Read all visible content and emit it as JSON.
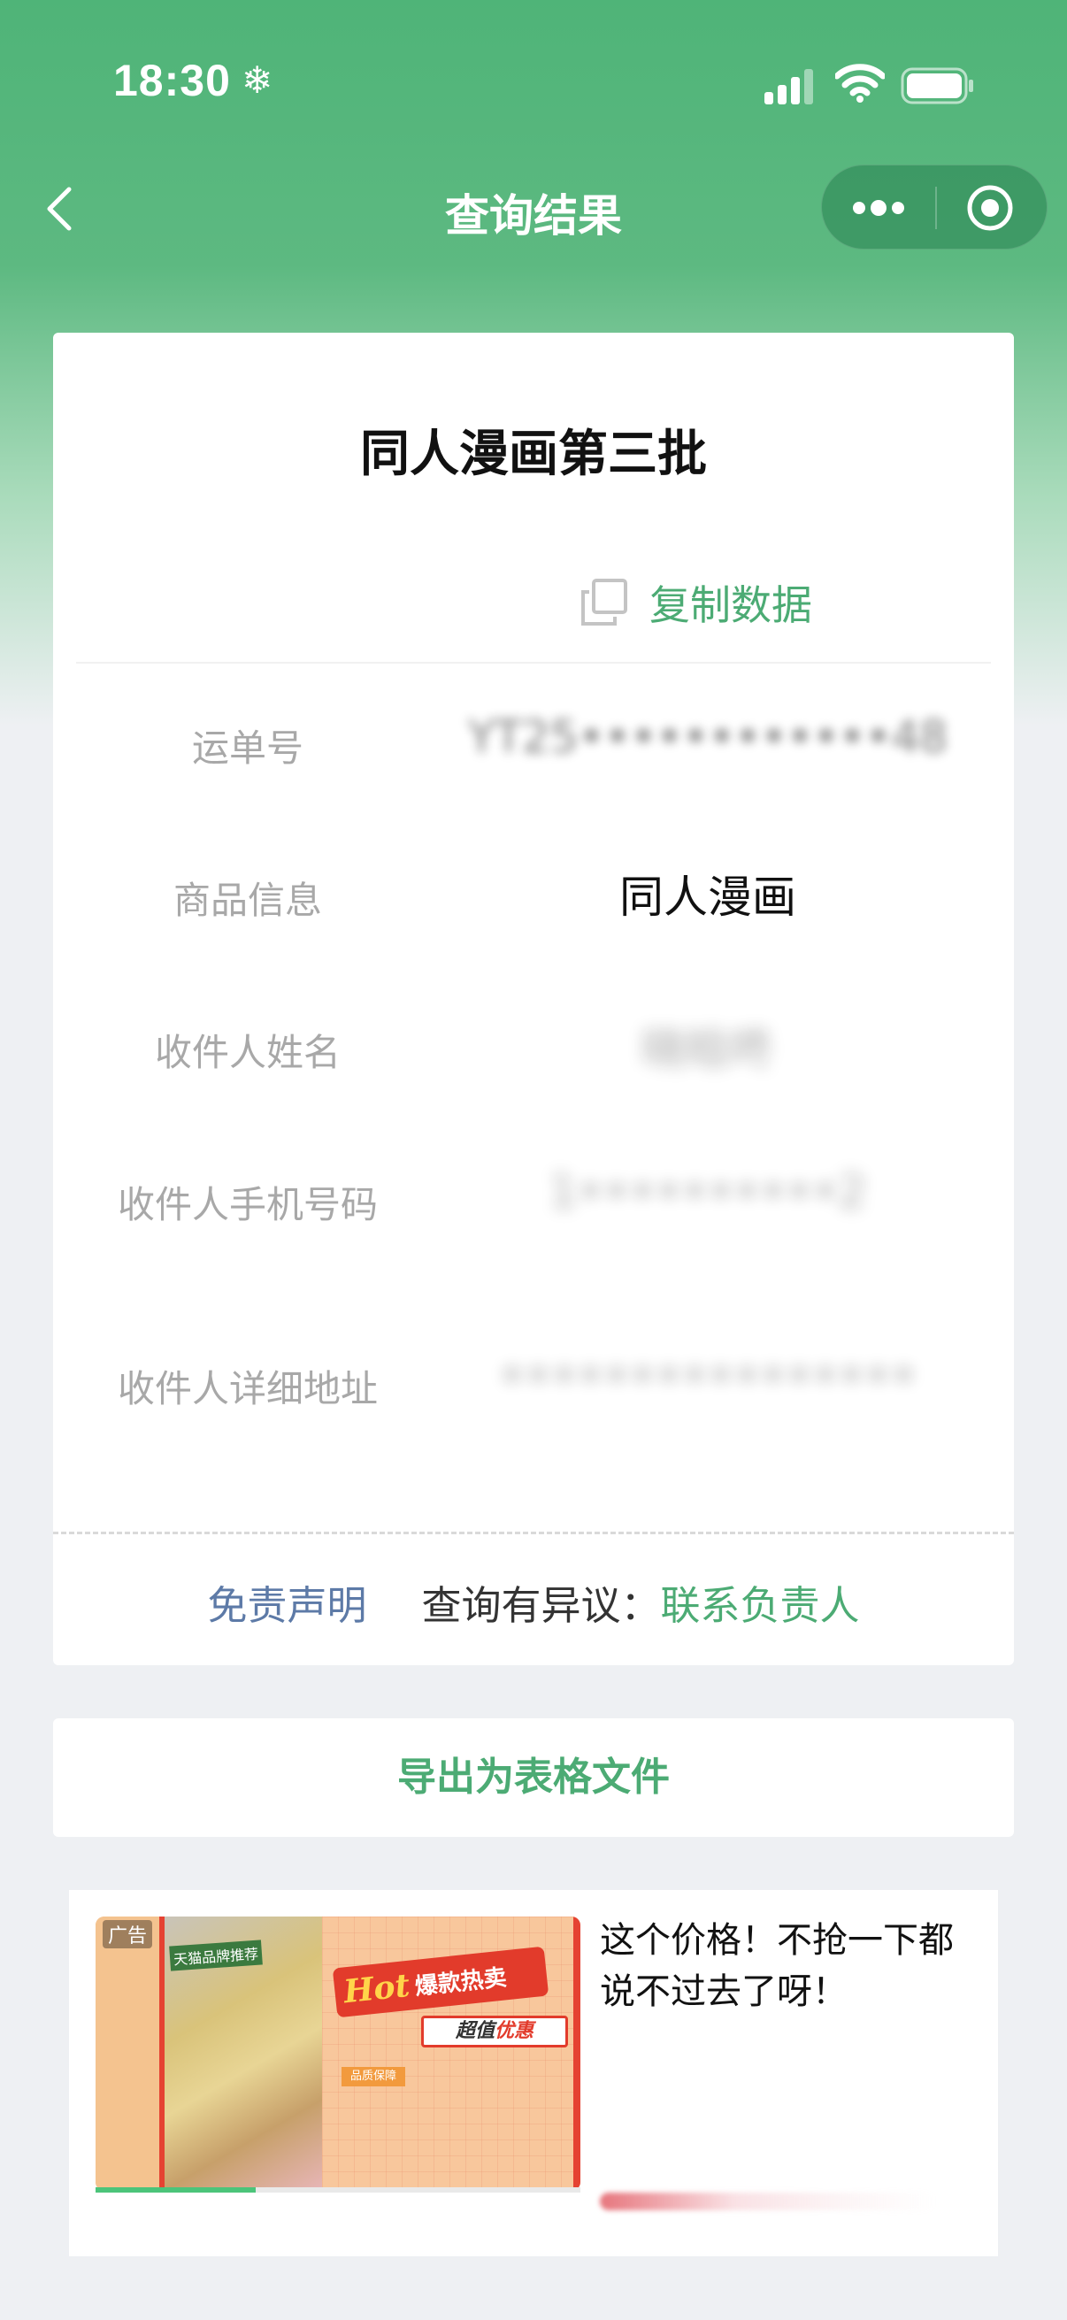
{
  "status_bar": {
    "time": "18:30",
    "icons": [
      "snowflake-icon",
      "cellular-signal-icon",
      "wifi-icon",
      "battery-icon"
    ]
  },
  "nav": {
    "title": "查询结果",
    "back_icon": "chevron-left-icon",
    "capsule_icons": [
      "more-dots-icon",
      "target-close-icon"
    ]
  },
  "card": {
    "title": "同人漫画第三批",
    "copy_label": "复制数据",
    "rows": [
      {
        "label": "运单号",
        "value": "YT25••••••••••••48"
      },
      {
        "label": "商品信息",
        "value": "同人漫画"
      },
      {
        "label": "收件人姓名",
        "value": "晓晗咚"
      },
      {
        "label": "收件人手机号码",
        "value": "1••••••••••2"
      },
      {
        "label": "收件人详细地址",
        "value": "••••••••••••••••"
      }
    ],
    "footer": {
      "disclaimer": "免责声明",
      "question_prefix": "查询有异议：",
      "contact": "联系负责人"
    }
  },
  "export": {
    "label": "导出为表格文件"
  },
  "ad": {
    "tag": "广告",
    "text": "这个价格！不抢一下都说不过去了呀！",
    "hot_word": "Hot",
    "hot_text": "爆款热卖",
    "value_text_a": "超值",
    "value_text_b": "优惠",
    "small_label": "品质保障",
    "photo_caption": "天猫品牌推荐",
    "progress": 0.33
  },
  "colors": {
    "accent_green": "#4cab74",
    "header_green": "#4fb478",
    "link_blue": "#5d7aa7"
  }
}
